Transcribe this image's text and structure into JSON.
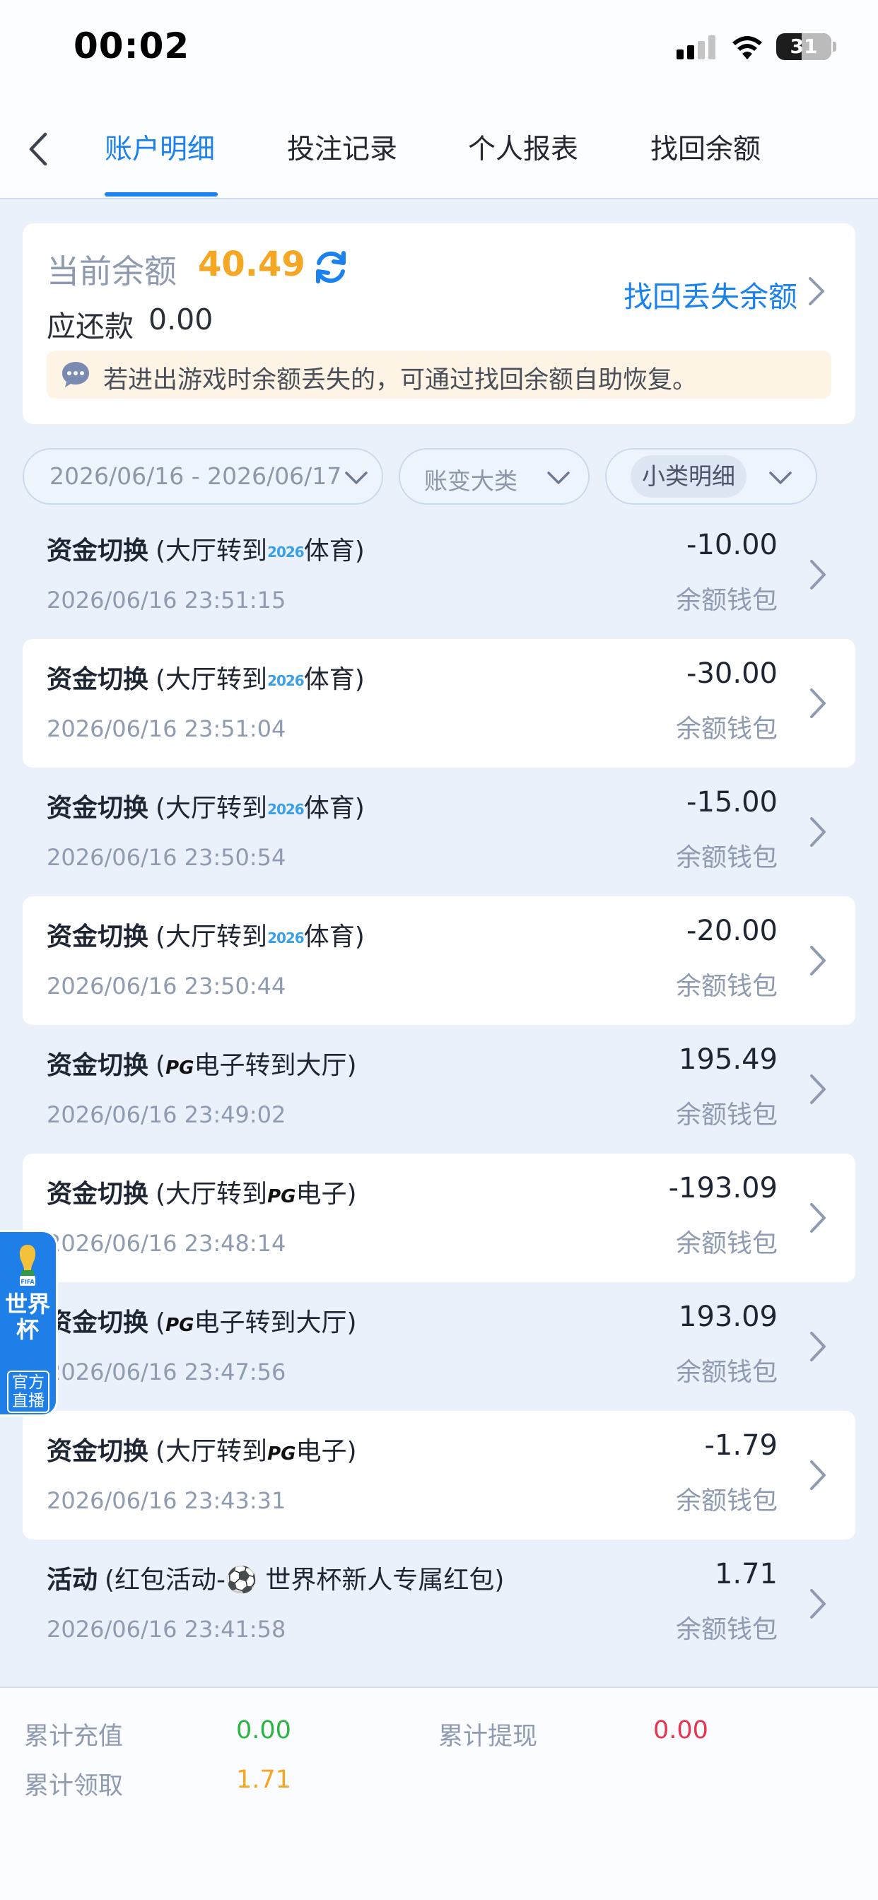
{
  "status_bar": {
    "time": "00:02",
    "battery": "31"
  },
  "nav": {
    "tabs": [
      {
        "label": "账户明细"
      },
      {
        "label": "投注记录"
      },
      {
        "label": "个人报表"
      },
      {
        "label": "找回余额"
      }
    ]
  },
  "balance": {
    "label": "当前余额",
    "value": "40.49",
    "repay_label": "应还款",
    "repay_value": "0.00",
    "recover_link": "找回丢失余额",
    "notice": "若进出游戏时余额丢失的，可通过找回余额自助恢复。"
  },
  "filters": {
    "date_range": "2026/06/16 - 2026/06/17",
    "category": "账变大类",
    "subcategory": "小类明细"
  },
  "records": [
    {
      "type": "资金切换",
      "pre": "(大厅转到",
      "tag": "2026",
      "post": "体育)",
      "time": "2026/06/16 23:51:15",
      "amount": "-10.00",
      "wallet": "余额钱包"
    },
    {
      "type": "资金切换",
      "pre": "(大厅转到",
      "tag": "2026",
      "post": "体育)",
      "time": "2026/06/16 23:51:04",
      "amount": "-30.00",
      "wallet": "余额钱包"
    },
    {
      "type": "资金切换",
      "pre": "(大厅转到",
      "tag": "2026",
      "post": "体育)",
      "time": "2026/06/16 23:50:54",
      "amount": "-15.00",
      "wallet": "余额钱包"
    },
    {
      "type": "资金切换",
      "pre": "(大厅转到",
      "tag": "2026",
      "post": "体育)",
      "time": "2026/06/16 23:50:44",
      "amount": "-20.00",
      "wallet": "余额钱包"
    },
    {
      "type": "资金切换",
      "pre": "(",
      "tag": "PG",
      "post": "电子转到大厅)",
      "time": "2026/06/16 23:49:02",
      "amount": "195.49",
      "wallet": "余额钱包"
    },
    {
      "type": "资金切换",
      "pre": "(大厅转到",
      "tag": "PG",
      "post": "电子)",
      "time": "2026/06/16 23:48:14",
      "amount": "-193.09",
      "wallet": "余额钱包"
    },
    {
      "type": "资金切换",
      "pre": "(",
      "tag": "PG",
      "post": "电子转到大厅)",
      "time": "2026/06/16 23:47:56",
      "amount": "193.09",
      "wallet": "余额钱包"
    },
    {
      "type": "资金切换",
      "pre": "(大厅转到",
      "tag": "PG",
      "post": "电子)",
      "time": "2026/06/16 23:43:31",
      "amount": "-1.79",
      "wallet": "余额钱包"
    },
    {
      "type": "活动",
      "pre": "(红包活动-⚽ 世界杯新人专属红包)",
      "tag": "",
      "post": "",
      "time": "2026/06/16 23:41:58",
      "amount": "1.71",
      "wallet": "余额钱包"
    }
  ],
  "worldcup_badge": {
    "fifa": "FIFA",
    "title": "世界杯",
    "sub": "官方直播"
  },
  "summary": {
    "recharge_label": "累计充值",
    "recharge_value": "0.00",
    "withdraw_label": "累计提现",
    "withdraw_value": "0.00",
    "claim_label": "累计领取",
    "claim_value": "1.71"
  },
  "colors": {
    "accent": "#1a82f0",
    "balance": "#f5a623",
    "green": "#2bb540",
    "red": "#e8344e"
  },
  "icons": [
    "back-icon",
    "refresh-icon",
    "chevron-right-icon",
    "message-icon",
    "chevron-down-icon",
    "trophy-icon",
    "wifi-icon",
    "signal-icon",
    "battery-icon"
  ]
}
